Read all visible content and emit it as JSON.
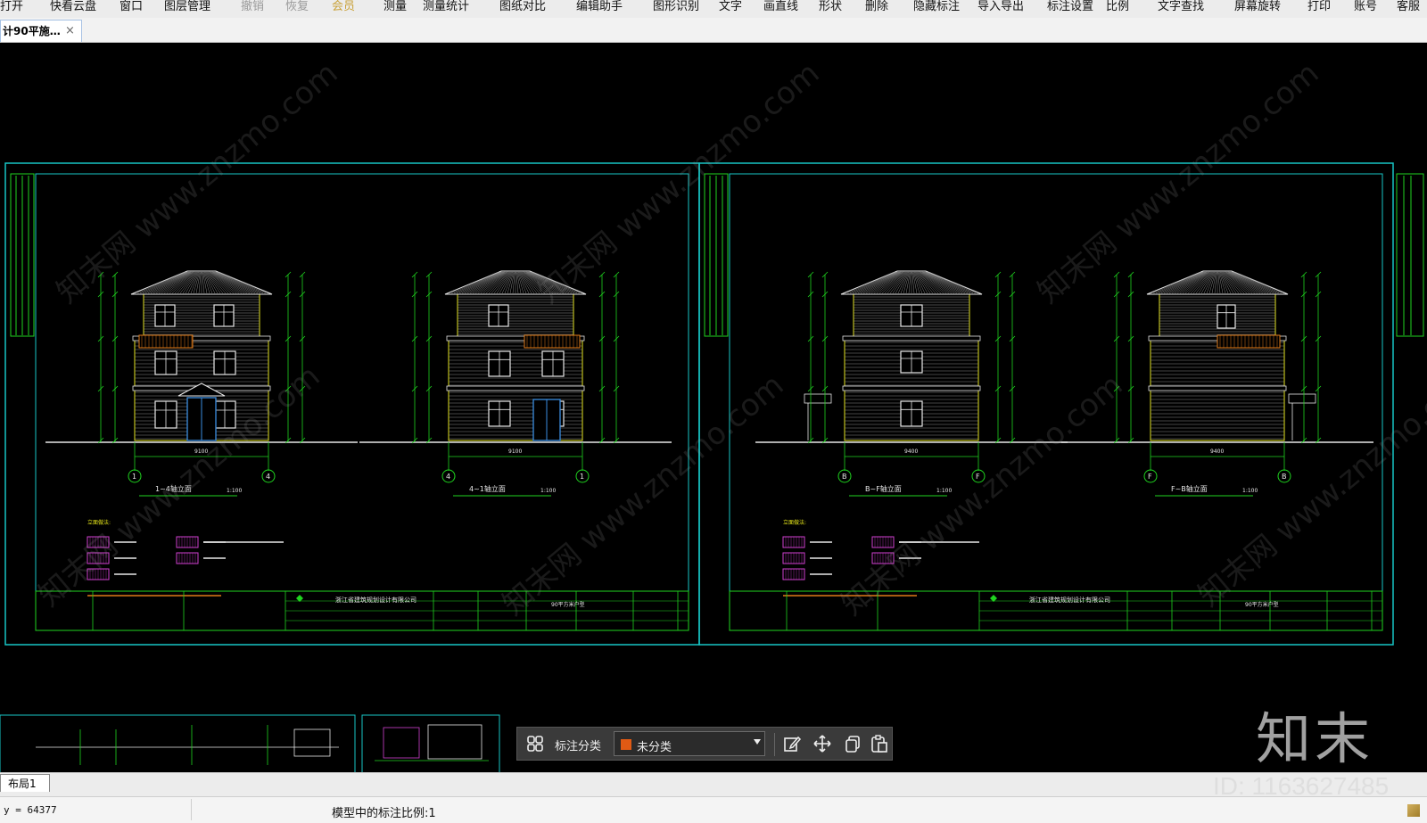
{
  "menu": {
    "items": [
      {
        "label": "打开",
        "state": "normal"
      },
      {
        "label": "快看云盘",
        "state": "normal"
      },
      {
        "label": "窗口",
        "state": "normal"
      },
      {
        "label": "图层管理",
        "state": "normal"
      },
      {
        "label": "撤销",
        "state": "disabled"
      },
      {
        "label": "恢复",
        "state": "disabled"
      },
      {
        "label": "会员",
        "state": "vip"
      },
      {
        "label": "测量",
        "state": "normal"
      },
      {
        "label": "测量统计",
        "state": "normal"
      },
      {
        "label": "图纸对比",
        "state": "normal"
      },
      {
        "label": "编辑助手",
        "state": "normal"
      },
      {
        "label": "图形识别",
        "state": "normal"
      },
      {
        "label": "文字",
        "state": "normal"
      },
      {
        "label": "画直线",
        "state": "normal"
      },
      {
        "label": "形状",
        "state": "normal"
      },
      {
        "label": "删除",
        "state": "normal"
      },
      {
        "label": "隐藏标注",
        "state": "normal"
      },
      {
        "label": "导入导出",
        "state": "normal"
      },
      {
        "label": "标注设置",
        "state": "normal"
      },
      {
        "label": "比例",
        "state": "normal"
      },
      {
        "label": "文字查找",
        "state": "normal"
      },
      {
        "label": "屏幕旋转",
        "state": "normal"
      },
      {
        "label": "打印",
        "state": "normal"
      },
      {
        "label": "账号",
        "state": "normal"
      },
      {
        "label": "客服",
        "state": "normal"
      }
    ]
  },
  "tabs": {
    "active_title": "计90平施…",
    "close_glyph": "×"
  },
  "drawing": {
    "view_titles": [
      "1~4轴立面",
      "4~1轴立面",
      "B~F轴立面",
      "F~B轴立面"
    ],
    "view_scale": "1:100",
    "axis_labels_left": [
      "1",
      "4",
      "4",
      "1"
    ],
    "axis_labels_right": [
      "B",
      "F",
      "F",
      "B"
    ],
    "dims": [
      "9100",
      "9100",
      "9400",
      "9400"
    ],
    "titleblock_company": "浙江省建筑规划设计有限公司",
    "titleblock_drawing": "90平方米户型",
    "legend_title": "立面做法:"
  },
  "overlay": {
    "brand": "知末",
    "watermark_text": "知末网 www.znzmo.com",
    "id_text": "ID: 1163627485"
  },
  "layout_tab": {
    "label": "布局1"
  },
  "status": {
    "coordinate": "y = 64377",
    "annotation_scale": "模型中的标注比例:1"
  },
  "annot_toolbar": {
    "category_label": "标注分类",
    "selected_category": "未分类",
    "swatch_color": "#e05a14"
  },
  "colors": {
    "cad_green": "#1fd31f",
    "cad_cyan": "#17c6c6",
    "cad_white": "#e8e8e8",
    "cad_yellow": "#e6e61a",
    "cad_magenta": "#d040d0",
    "cad_orange": "#e07a18",
    "cad_red": "#e63a3a"
  }
}
